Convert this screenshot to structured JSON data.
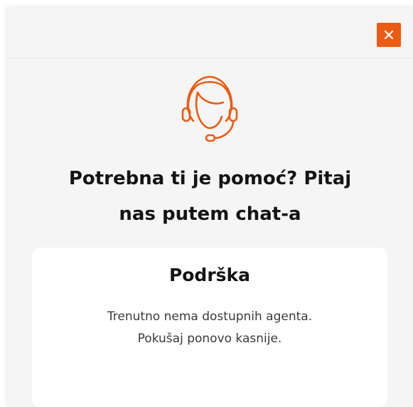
{
  "header": {
    "close_icon": "close-icon",
    "accent_color": "#ea5b13"
  },
  "hero": {
    "icon": "support-agent-headset-icon",
    "headline_line1": "Potrebna ti je pomoć? Pitaj",
    "headline_line2": "nas putem chat-a"
  },
  "card": {
    "title": "Podrška",
    "message_line1": "Trenutno nema dostupnih agenta.",
    "message_line2": "Pokušaj ponovo kasnije."
  }
}
